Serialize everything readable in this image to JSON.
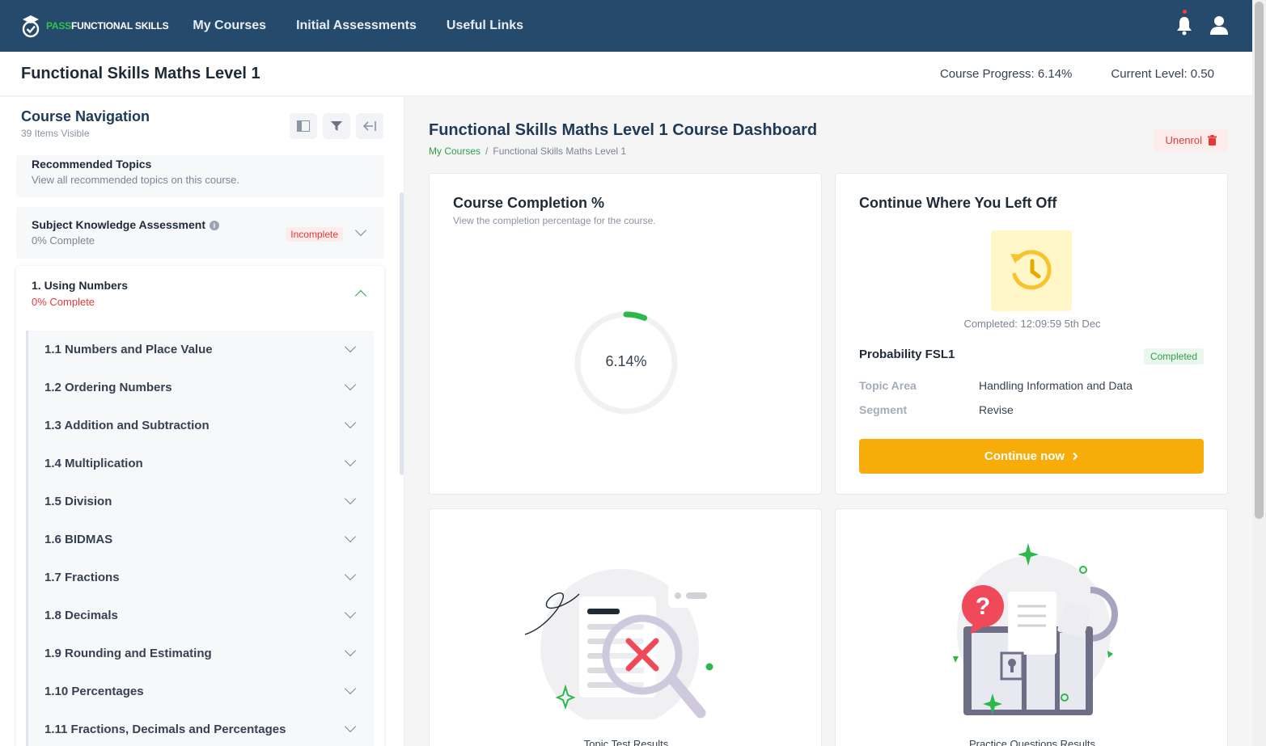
{
  "brand": {
    "part1": "PASS",
    "part2": "FUNCTIONAL SKILLS"
  },
  "nav": {
    "links": [
      "My Courses",
      "Initial Assessments",
      "Useful Links"
    ]
  },
  "header": {
    "course_title": "Functional Skills Maths Level 1",
    "progress_label": "Course Progress:",
    "progress_value": "6.14%",
    "level_label": "Current Level:",
    "level_value": "0.50"
  },
  "sidebar": {
    "title": "Course Navigation",
    "subtitle": "39 Items Visible",
    "recommended": {
      "title": "Recommended Topics",
      "subtitle": "View all recommended topics on this course."
    },
    "ska": {
      "title": "Subject Knowledge Assessment",
      "subtitle": "0% Complete",
      "badge": "Incomplete"
    },
    "unit": {
      "title": "1. Using Numbers",
      "subtitle": "0% Complete"
    },
    "topics": [
      "1.1 Numbers and Place Value",
      "1.2 Ordering Numbers",
      "1.3 Addition and Subtraction",
      "1.4 Multiplication",
      "1.5 Division",
      "1.6 BIDMAS",
      "1.7 Fractions",
      "1.8 Decimals",
      "1.9 Rounding and Estimating",
      "1.10 Percentages",
      "1.11 Fractions, Decimals and Percentages"
    ]
  },
  "main": {
    "title": "Functional Skills Maths Level 1 Course Dashboard",
    "breadcrumb": [
      "My Courses",
      "Functional Skills Maths Level 1"
    ],
    "unenrol": "Unenrol",
    "completion": {
      "title": "Course Completion %",
      "subtitle": "View the completion percentage for the course.",
      "label": "6.14%",
      "value": 6.14
    },
    "continue": {
      "title": "Continue Where You Left Off",
      "completed_at": "Completed: 12:09:59 5th Dec",
      "topic": "Probability FSL1",
      "badge": "Completed",
      "topic_area_label": "Topic Area",
      "topic_area": "Handling Information and Data",
      "segment_label": "Segment",
      "segment": "Revise",
      "button": "Continue now"
    },
    "topic_test": {
      "label": "Topic Test Results"
    },
    "practice": {
      "label": "Practice Questions Results"
    }
  },
  "colors": {
    "nav_bg": "#264a6b",
    "accent_green": "#33c24a",
    "cta": "#f7ac0a",
    "danger": "#e53935"
  }
}
